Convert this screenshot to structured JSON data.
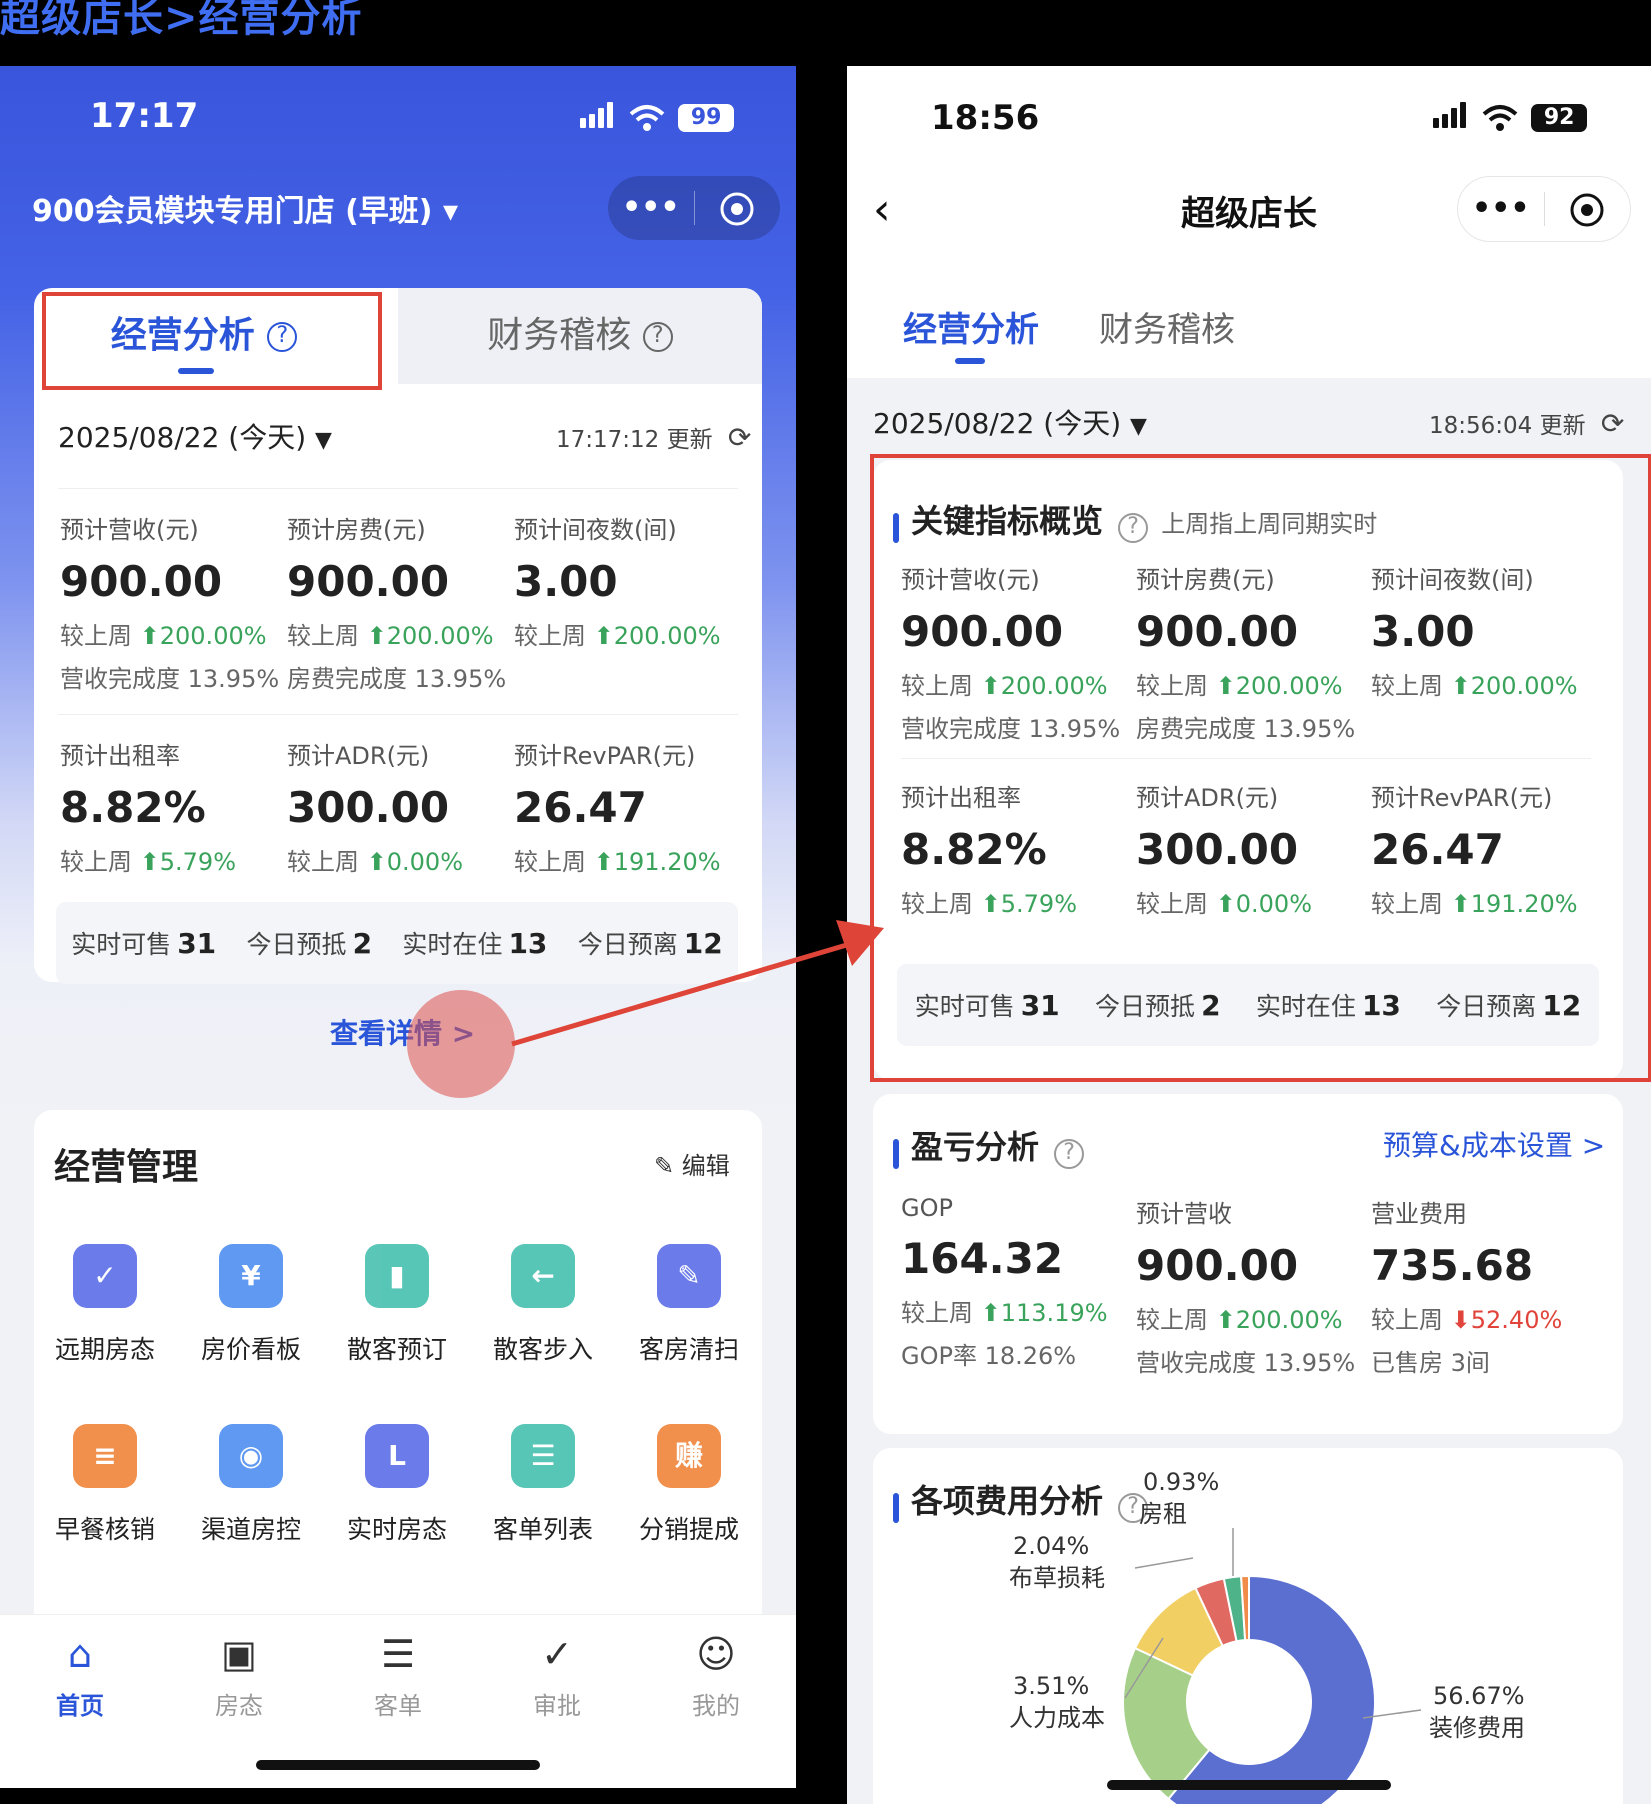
{
  "doc_title": "超级店长>经营分析",
  "left": {
    "status": {
      "time": "17:17",
      "battery": "99"
    },
    "store_name": "900会员模块专用门店 (早班)",
    "tabs": [
      {
        "label": "经营分析"
      },
      {
        "label": "财务稽核"
      }
    ],
    "date": "2025/08/22 (今天)",
    "update_time": "17:17:12 更新",
    "metrics_row1": [
      {
        "label": "预计营收(元)",
        "value": "900.00",
        "cmp_prefix": "较上周",
        "cmp": "200.00%",
        "sub": "营收完成度 13.95%"
      },
      {
        "label": "预计房费(元)",
        "value": "900.00",
        "cmp_prefix": "较上周",
        "cmp": "200.00%",
        "sub": "房费完成度 13.95%"
      },
      {
        "label": "预计间夜数(间)",
        "value": "3.00",
        "cmp_prefix": "较上周",
        "cmp": "200.00%",
        "sub": ""
      }
    ],
    "metrics_row2": [
      {
        "label": "预计出租率",
        "value": "8.82%",
        "cmp_prefix": "较上周",
        "cmp": "5.79%"
      },
      {
        "label": "预计ADR(元)",
        "value": "300.00",
        "cmp_prefix": "较上周",
        "cmp": "0.00%"
      },
      {
        "label": "预计RevPAR(元)",
        "value": "26.47",
        "cmp_prefix": "较上周",
        "cmp": "191.20%"
      }
    ],
    "stats": [
      {
        "label": "实时可售",
        "value": "31"
      },
      {
        "label": "今日预抵",
        "value": "2"
      },
      {
        "label": "实时在住",
        "value": "13"
      },
      {
        "label": "今日预离",
        "value": "12"
      }
    ],
    "details_link": "查看详情 >",
    "mgmt_title": "经营管理",
    "mgmt_edit": "编辑",
    "mgmt_items": [
      {
        "label": "远期房态",
        "icon": "calendar-icon",
        "color": "#5b6ee8"
      },
      {
        "label": "房价看板",
        "icon": "yen-house-icon",
        "color": "#4f8ff0"
      },
      {
        "label": "散客预订",
        "icon": "booking-icon",
        "color": "#47c0b0"
      },
      {
        "label": "散客步入",
        "icon": "walk-in-icon",
        "color": "#47c0b0"
      },
      {
        "label": "客房清扫",
        "icon": "broom-icon",
        "color": "#5b6ee8"
      },
      {
        "label": "早餐核销",
        "icon": "ticket-icon",
        "color": "#f0833a"
      },
      {
        "label": "渠道房控",
        "icon": "monitor-icon",
        "color": "#4f8ff0"
      },
      {
        "label": "实时房态",
        "icon": "realtime-room-icon",
        "color": "#5b6ee8"
      },
      {
        "label": "客单列表",
        "icon": "list-icon",
        "color": "#47c0b0"
      },
      {
        "label": "分销提成",
        "icon": "commission-icon",
        "color": "#f0833a"
      }
    ],
    "nav": [
      {
        "label": "首页",
        "active": true
      },
      {
        "label": "房态",
        "active": false
      },
      {
        "label": "客单",
        "active": false
      },
      {
        "label": "审批",
        "active": false
      },
      {
        "label": "我的",
        "active": false
      }
    ]
  },
  "right": {
    "status": {
      "time": "18:56",
      "battery": "92"
    },
    "nav_title": "超级店长",
    "tabs": [
      {
        "label": "经营分析"
      },
      {
        "label": "财务稽核"
      }
    ],
    "date": "2025/08/22 (今天)",
    "update_time": "18:56:04 更新",
    "kpi_title": "关键指标概览",
    "kpi_note": "上周指上周同期实时",
    "metrics_row1": [
      {
        "label": "预计营收(元)",
        "value": "900.00",
        "cmp_prefix": "较上周",
        "cmp": "200.00%",
        "sub": "营收完成度 13.95%"
      },
      {
        "label": "预计房费(元)",
        "value": "900.00",
        "cmp_prefix": "较上周",
        "cmp": "200.00%",
        "sub": "房费完成度 13.95%"
      },
      {
        "label": "预计间夜数(间)",
        "value": "3.00",
        "cmp_prefix": "较上周",
        "cmp": "200.00%",
        "sub": ""
      }
    ],
    "metrics_row2": [
      {
        "label": "预计出租率",
        "value": "8.82%",
        "cmp_prefix": "较上周",
        "cmp": "5.79%"
      },
      {
        "label": "预计ADR(元)",
        "value": "300.00",
        "cmp_prefix": "较上周",
        "cmp": "0.00%"
      },
      {
        "label": "预计RevPAR(元)",
        "value": "26.47",
        "cmp_prefix": "较上周",
        "cmp": "191.20%"
      }
    ],
    "stats": [
      {
        "label": "实时可售",
        "value": "31"
      },
      {
        "label": "今日预抵",
        "value": "2"
      },
      {
        "label": "实时在住",
        "value": "13"
      },
      {
        "label": "今日预离",
        "value": "12"
      }
    ],
    "pl_title": "盈亏分析",
    "pl_link": "预算&成本设置 >",
    "pl_metrics": [
      {
        "label": "GOP",
        "value": "164.32",
        "cmp_prefix": "较上周",
        "cmp": "113.19%",
        "dir": "up",
        "sub": "GOP率 18.26%"
      },
      {
        "label": "预计营收",
        "value": "900.00",
        "cmp_prefix": "较上周",
        "cmp": "200.00%",
        "dir": "up",
        "sub": "营收完成度 13.95%"
      },
      {
        "label": "营业费用",
        "value": "735.68",
        "cmp_prefix": "较上周",
        "cmp": "52.40%",
        "dir": "down",
        "sub": "已售房 3间"
      }
    ],
    "cost_title": "各项费用分析",
    "chart_data": {
      "type": "pie",
      "title": "各项费用分析",
      "categories": [
        "装修费用",
        "人力成本",
        "布草损耗",
        "房租"
      ],
      "values": [
        56.67,
        3.51,
        2.04,
        0.93
      ],
      "labels": [
        "56.67%",
        "3.51%",
        "2.04%",
        "0.93%"
      ],
      "colors": [
        "#5a6fd0",
        "#a6d08a",
        "#f2cf63",
        "#f08b4a",
        "#e06a62",
        "#4fb38a",
        "#e06a62"
      ]
    }
  },
  "colors": {
    "accent": "#2a55d8",
    "up": "#3aa35b",
    "down": "#e0443a",
    "highlight": "#de4437"
  }
}
